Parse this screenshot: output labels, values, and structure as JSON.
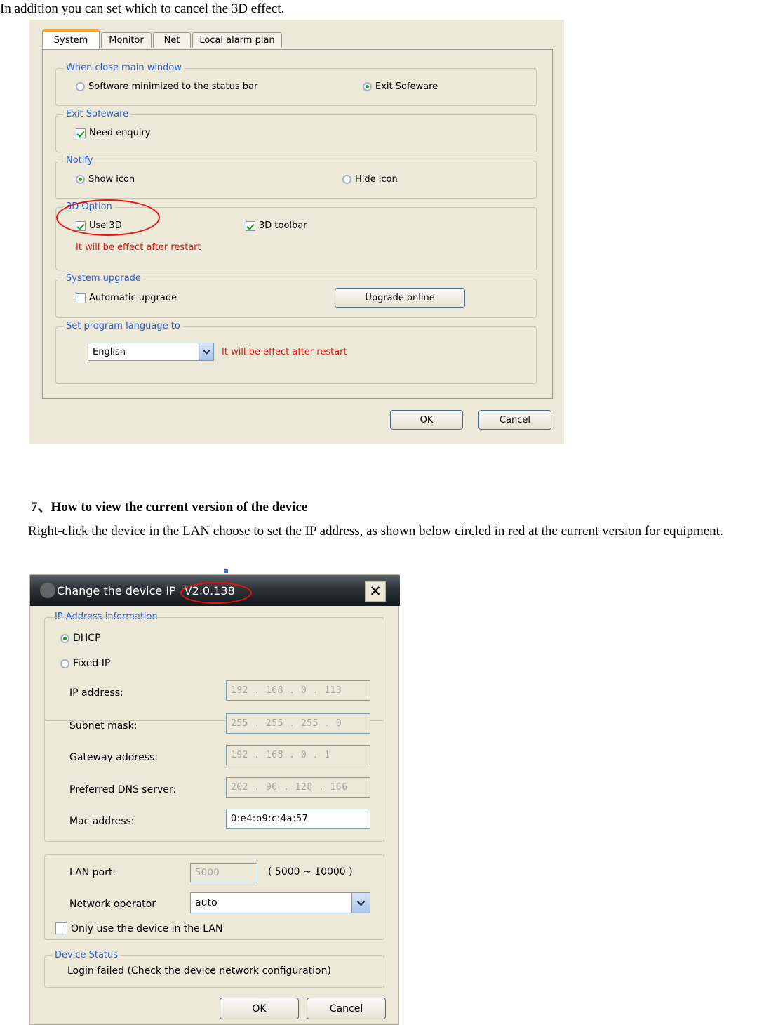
{
  "document": {
    "intro_line": "In addition you can set which to cancel the 3D effect.",
    "section_heading": "7、How to view the current version of the device",
    "section_paragraph": "Right-click the device in the LAN choose to set the IP address, as shown below circled in red at the current version for equipment."
  },
  "settings_dialog": {
    "tabs": [
      {
        "label": "System",
        "active": true
      },
      {
        "label": "Monitor",
        "active": false
      },
      {
        "label": "Net",
        "active": false
      },
      {
        "label": "Local alarm plan",
        "active": false
      }
    ],
    "group_close_window": {
      "title": "When close main window",
      "option_minimize": "Software minimized to the status bar",
      "option_minimize_selected": false,
      "option_exit": "Exit Sofeware",
      "option_exit_selected": true
    },
    "group_exit_software": {
      "title": "Exit Sofeware",
      "need_enquiry_label": "Need enquiry",
      "need_enquiry_checked": true
    },
    "group_notify": {
      "title": "Notify",
      "option_show": "Show icon",
      "option_show_selected": true,
      "option_hide": "Hide icon",
      "option_hide_selected": false
    },
    "group_3d": {
      "title": "3D Option",
      "use_3d_label": "Use 3D",
      "use_3d_checked": true,
      "toolbar_3d_label": "3D toolbar",
      "toolbar_3d_checked": true,
      "restart_note": "It will be effect after restart"
    },
    "group_upgrade": {
      "title": "System upgrade",
      "automatic_label": "Automatic upgrade",
      "automatic_checked": false,
      "upgrade_button": "Upgrade online"
    },
    "group_language": {
      "title": "Set program language to",
      "selected_language": "English",
      "restart_note": "It will be effect after restart"
    },
    "ok_button": "OK",
    "cancel_button": "Cancel"
  },
  "device_ip_dialog": {
    "title": "Change the device IP",
    "version": "V2.0.138",
    "close_icon_label": "✕",
    "group_ip": {
      "title": "IP Address information",
      "option_dhcp": "DHCP",
      "option_dhcp_selected": true,
      "option_fixed": "Fixed IP",
      "option_fixed_selected": false,
      "fields": [
        {
          "label": "IP address:",
          "value": "192 . 168 .  0   . 113",
          "disabled": true
        },
        {
          "label": "Subnet mask:",
          "value": "255 . 255 . 255 .  0",
          "disabled": true
        },
        {
          "label": "Gateway address:",
          "value": "192 . 168 .  0   .  1",
          "disabled": true
        },
        {
          "label": "Preferred DNS server:",
          "value": "202 . 96  . 128 . 166",
          "disabled": true
        },
        {
          "label": "Mac address:",
          "value": "0:e4:b9:c:4a:57",
          "disabled": false
        }
      ]
    },
    "group_lan": {
      "lan_port_label": "LAN port:",
      "lan_port_value": "5000",
      "lan_port_range": "( 5000 ~ 10000 )",
      "network_operator_label": "Network operator",
      "network_operator_value": "auto",
      "only_lan_label": "Only use the device in the LAN",
      "only_lan_checked": false
    },
    "group_status": {
      "title": "Device Status",
      "message": "Login failed (Check the device network configuration)"
    },
    "ok_button": "OK",
    "cancel_button": "Cancel"
  }
}
